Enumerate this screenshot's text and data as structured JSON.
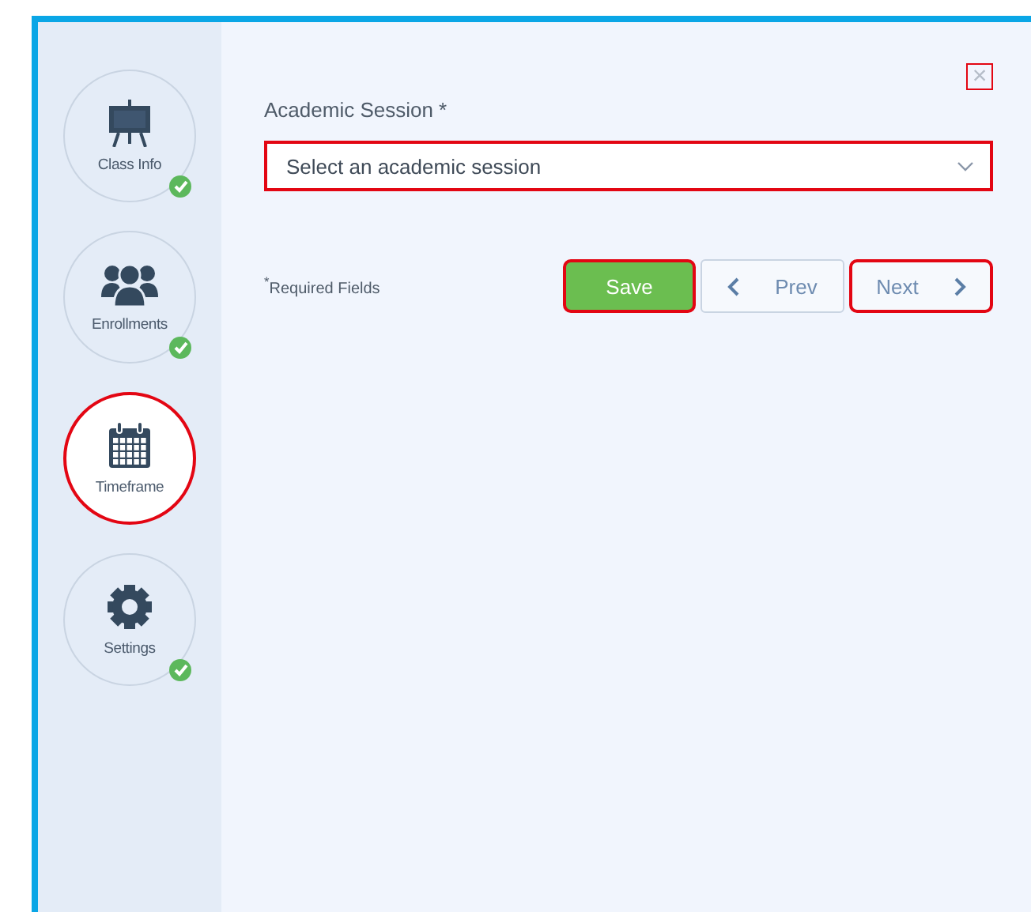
{
  "close_button": {
    "label": "×",
    "highlighted": true
  },
  "steps": [
    {
      "label": "Class Info",
      "kind": "easel",
      "completed": true,
      "selected": false,
      "highlighted": false
    },
    {
      "label": "Enrollments",
      "kind": "people",
      "completed": true,
      "selected": false,
      "highlighted": false
    },
    {
      "label": "Timeframe",
      "kind": "calendar",
      "completed": false,
      "selected": true,
      "highlighted": true
    },
    {
      "label": "Settings",
      "kind": "gear",
      "completed": true,
      "selected": false,
      "highlighted": false
    }
  ],
  "field": {
    "label": "Academic Session *",
    "placeholder": "Select an academic session",
    "highlighted": true
  },
  "required_note": "$^{*}$Required Fields",
  "buttons": [
    {
      "label": "Save",
      "kind": "save",
      "highlighted": true
    },
    {
      "label": "Prev",
      "kind": "prev",
      "highlighted": false
    },
    {
      "label": "Next",
      "kind": "next",
      "highlighted": true
    }
  ]
}
